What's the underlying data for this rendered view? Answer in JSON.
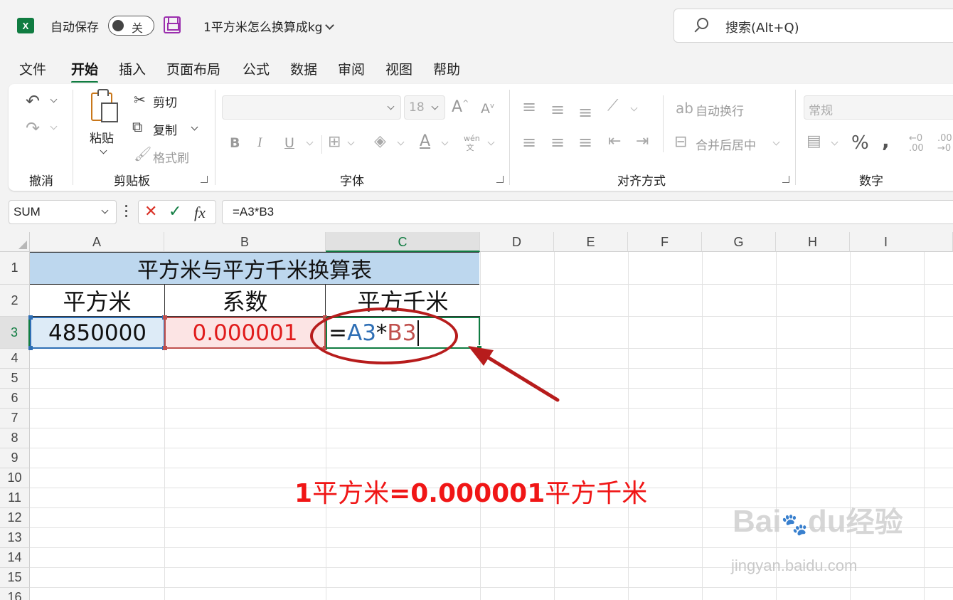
{
  "titlebar": {
    "logo_letter": "X",
    "autosave_label": "自动保存",
    "autosave_state": "关",
    "document_title": "1平方米怎么换算成kg",
    "search_placeholder": "搜索(Alt+Q)"
  },
  "menu": {
    "tabs": [
      "文件",
      "开始",
      "插入",
      "页面布局",
      "公式",
      "数据",
      "审阅",
      "视图",
      "帮助"
    ],
    "active": "开始"
  },
  "ribbon": {
    "undo_group": "撤消",
    "clipboard": {
      "paste": "粘贴",
      "cut": "剪切",
      "copy": "复制",
      "format_painter": "格式刷",
      "group_label": "剪贴板"
    },
    "font": {
      "font_name": "",
      "font_size": "18",
      "group_label": "字体",
      "bold": "B",
      "italic": "I",
      "underline": "U",
      "grow": "A",
      "shrink": "A",
      "phonetic": "wén"
    },
    "alignment": {
      "wrap_text": "自动换行",
      "merge_center": "合并后居中",
      "group_label": "对齐方式"
    },
    "number": {
      "format": "常规",
      "group_label": "数字",
      "percent": "%"
    }
  },
  "formula_bar": {
    "name_box": "SUM",
    "cancel_glyph": "✕",
    "enter_glyph": "✓",
    "fx_label": "fx",
    "formula": "=A3*B3"
  },
  "grid": {
    "columns": [
      "A",
      "B",
      "C",
      "D",
      "E",
      "F",
      "G",
      "H",
      "I"
    ],
    "rows": [
      "1",
      "2",
      "3",
      "4",
      "5",
      "6",
      "7",
      "8",
      "9",
      "10",
      "11",
      "12",
      "13",
      "14",
      "15",
      "16"
    ],
    "active_column": "C",
    "active_row": "3",
    "table_title": "平方米与平方千米换算表",
    "headers": [
      "平方米",
      "系数",
      "平方千米"
    ],
    "row3": {
      "a": "4850000",
      "b": "0.000001",
      "c_parts": [
        "=",
        "A3",
        "*",
        "B3"
      ]
    }
  },
  "annotation": {
    "note_parts": [
      "1",
      "平方米",
      "=0.000001",
      "平方千米"
    ],
    "colors": {
      "ring": "#b71c1c",
      "note": "#f01616",
      "arrow": "#b71c1c"
    }
  },
  "watermark": {
    "brand": "Bai",
    "brand_mid": "du",
    "brand_cn": "经验",
    "url": "jingyan.baidu.com"
  },
  "colors": {
    "accent": "#107c41",
    "title_fill": "#bdd7ee",
    "ref_a": "#2f6fb5",
    "ref_b": "#c0504d"
  }
}
